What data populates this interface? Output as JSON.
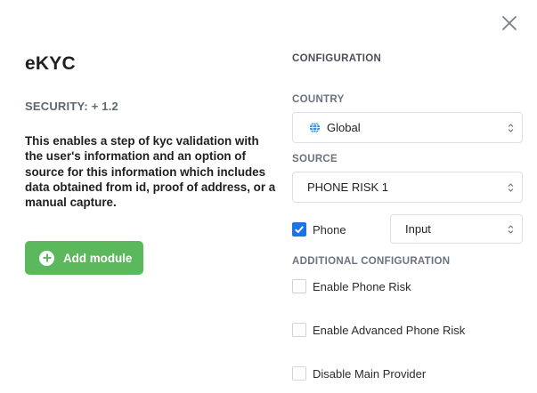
{
  "modal": {
    "close_icon": "close-icon"
  },
  "module": {
    "title": "eKYC",
    "security": "SECURITY: + 1.2",
    "description": "This enables a step of kyc validation with the user's information and an option of source for this information which includes data obtained from id, proof of address, or a manual capture.",
    "add_button_label": "Add module",
    "add_button_icon": "plus-circle-icon",
    "accent_color": "#5cb85c"
  },
  "configuration": {
    "heading": "CONFIGURATION",
    "country": {
      "label": "COUNTRY",
      "value": "Global",
      "icon": "globe-icon"
    },
    "source": {
      "label": "SOURCE",
      "value": "PHONE RISK 1"
    },
    "phone": {
      "label": "Phone",
      "checked": true,
      "mode_value": "Input"
    },
    "additional": {
      "heading": "ADDITIONAL CONFIGURATION",
      "options": [
        {
          "label": "Enable Phone Risk",
          "checked": false
        },
        {
          "label": "Enable Advanced Phone Risk",
          "checked": false
        },
        {
          "label": "Disable Main Provider",
          "checked": false
        }
      ]
    },
    "checkbox_color": "#1a73e8"
  }
}
